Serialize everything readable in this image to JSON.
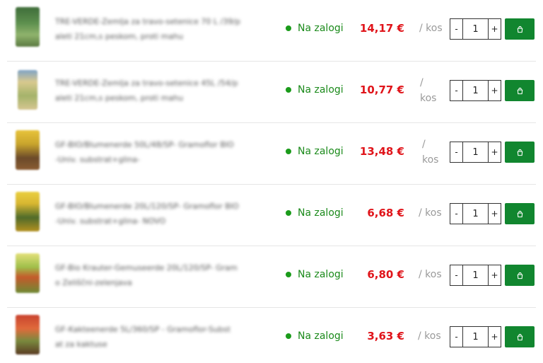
{
  "colors": {
    "in_stock": "#1b8a1b",
    "price": "#e0141a",
    "cart_button": "#11862f"
  },
  "icons": {
    "stock": "dot-icon",
    "minus": "minus-icon",
    "plus": "plus-icon",
    "cart": "cart-icon"
  },
  "products": [
    {
      "name_line1": "TRE-VERDE-Zemlja za travo-setenice 70 L /39/p",
      "name_line2": "aleti 21cm,s peskom, proti mahu",
      "stock": "Na zalogi",
      "price": "14,17 €",
      "unit": "/ kos",
      "minus": "-",
      "qty": "1",
      "plus": "+"
    },
    {
      "name_line1": "TRE-VERDE-Zemlja za travo-setenice 45L /54/p",
      "name_line2": "aleti 21cm,s peskom, proti mahu",
      "stock": "Na zalogi",
      "price": "10,77 €",
      "unit": "/ kos",
      "minus": "-",
      "qty": "1",
      "plus": "+"
    },
    {
      "name_line1": "GF-BIO/Blumenerde 50L/48/SP- Gramoflor BIO",
      "name_line2": "-Univ. substrat+glina-",
      "stock": "Na zalogi",
      "price": "13,48 €",
      "unit": "/ kos",
      "minus": "-",
      "qty": "1",
      "plus": "+"
    },
    {
      "name_line1": "GF-BIO/Blumenerde 20L/120/SP- Gramoflor BIO",
      "name_line2": "-Univ. substrat+glina- NOVO",
      "stock": "Na zalogi",
      "price": "6,68 €",
      "unit": "/ kos",
      "minus": "-",
      "qty": "1",
      "plus": "+"
    },
    {
      "name_line1": "GF-Bio Krauter-Gemuseerde 20L/120/SP- Gram",
      "name_line2": "o Zeliščni-zelenjava",
      "stock": "Na zalogi",
      "price": "6,80 €",
      "unit": "/ kos",
      "minus": "-",
      "qty": "1",
      "plus": "+"
    },
    {
      "name_line1": "GF-Kakteenerde 5L/360/SP - Gramoflor-Subst",
      "name_line2": "at za kaktuse",
      "stock": "Na zalogi",
      "price": "3,63 €",
      "unit": "/ kos",
      "minus": "-",
      "qty": "1",
      "plus": "+"
    }
  ]
}
